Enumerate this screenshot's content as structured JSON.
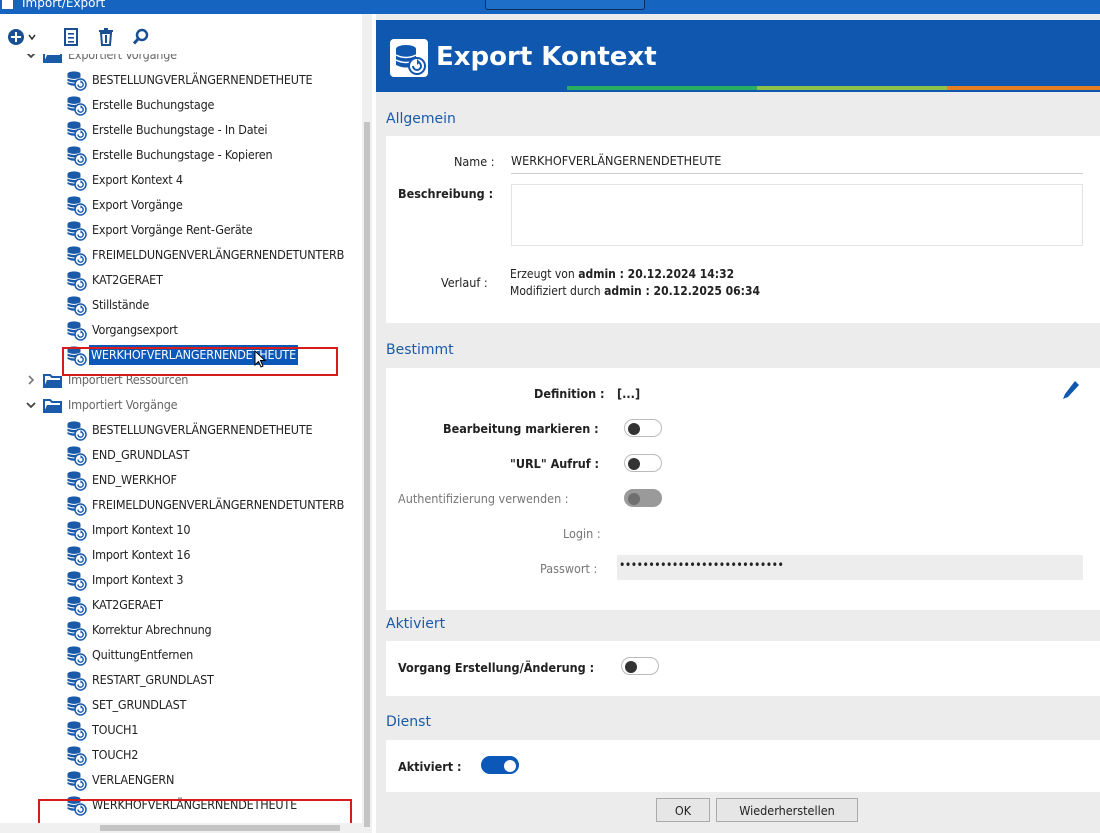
{
  "window": {
    "title": "Import/Export"
  },
  "toolbar": {
    "icons": [
      "add-icon",
      "chevron-down-icon",
      "document-icon",
      "trash-icon",
      "search-icon"
    ]
  },
  "tree": {
    "groups": [
      {
        "label": "Exportiert Vorgänge",
        "expanded": true,
        "items": [
          "BESTELLUNGVERLÄNGERNENDETHEUTE",
          "Erstelle Buchungstage",
          "Erstelle Buchungstage - In Datei",
          "Erstelle Buchungstage - Kopieren",
          "Export Kontext 4",
          "Export Vorgänge",
          "Export Vorgänge Rent-Geräte",
          "FREIMELDUNGENVERLÄNGERNENDETUNTERB",
          "KAT2GERAET",
          "Stillstände",
          "Vorgangsexport",
          "WERKHOFVERLÄNGERNENDETHEUTE"
        ]
      },
      {
        "label": "Importiert Ressourcen",
        "expanded": false,
        "items": []
      },
      {
        "label": "Importiert Vorgänge",
        "expanded": true,
        "items": [
          "BESTELLUNGVERLÄNGERNENDETHEUTE",
          "END_GRUNDLAST",
          "END_WERKHOF",
          "FREIMELDUNGENVERLÄNGERNENDETUNTERB",
          "Import Kontext 10",
          "Import Kontext 16",
          "Import Kontext 3",
          "KAT2GERAET",
          "Korrektur Abrechnung",
          "QuittungEntfernen",
          "RESTART_GRUNDLAST",
          "SET_GRUNDLAST",
          "TOUCH1",
          "TOUCH2",
          "VERLAENGERN",
          "WERKHOFVERLÄNGERNENDETHEUTE"
        ]
      }
    ],
    "selected": "WERKHOFVERLÄNGERNENDETHEUTE"
  },
  "panel": {
    "title": "Export Kontext",
    "stripe_colors": [
      "#1057b0",
      "#27ae60",
      "#8bc34a",
      "#e67e22"
    ],
    "allgemein": {
      "section": "Allgemein",
      "name_label": "Name :",
      "name_value": "WERKHOFVERLÄNGERNENDETHEUTE",
      "beschreibung_label": "Beschreibung :",
      "beschreibung_value": "",
      "verlauf_label": "Verlauf :",
      "created_prefix": "Erzeugt von",
      "created_value": "admin : 20.12.2024 14:32",
      "modified_prefix": "Modifiziert durch",
      "modified_value": "admin : 20.12.2025 06:34"
    },
    "bestimmt": {
      "section": "Bestimmt",
      "definition_label": "Definition :",
      "definition_value": "[...]",
      "bearbeitung_label": "Bearbeitung markieren :",
      "bearbeitung_on": false,
      "url_label": "\"URL\" Aufruf :",
      "url_on": false,
      "auth_label": "Authentifizierung verwenden :",
      "auth_on": false,
      "login_label": "Login :",
      "login_value": "",
      "passwort_label": "Passwort :",
      "passwort_value": "••••••••••••••••••••••••••••"
    },
    "aktiviert": {
      "section": "Aktiviert",
      "vorgang_label": "Vorgang Erstellung/Änderung :",
      "vorgang_on": false
    },
    "dienst": {
      "section": "Dienst",
      "aktiviert_label": "Aktiviert :",
      "aktiviert_on": true
    },
    "buttons": {
      "ok": "OK",
      "restore": "Wiederherstellen"
    }
  }
}
